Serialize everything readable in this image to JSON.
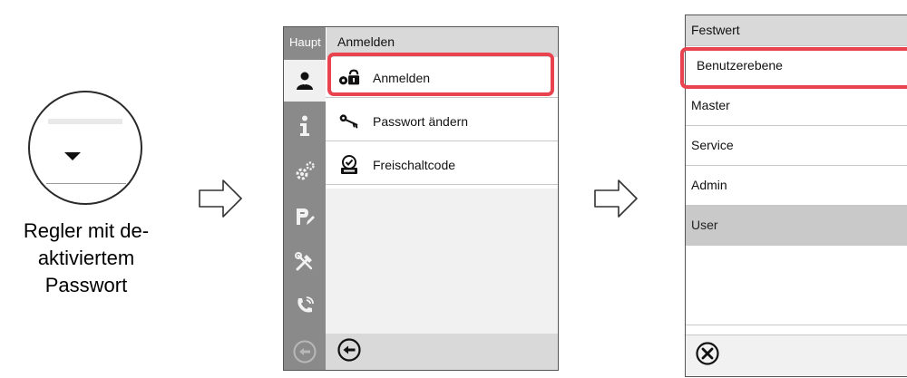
{
  "controller": {
    "caption_lines": [
      "Regler mit de-",
      "aktiviertem",
      "Passwort"
    ],
    "icon": "chevron-down-icon"
  },
  "login_screen": {
    "sidebar_title": "Haupt",
    "header_title": "Anmelden",
    "sidebar_icons": [
      "user-icon",
      "info-icon",
      "settings-icon",
      "program-edit-icon",
      "service-tools-icon",
      "phone-icon"
    ],
    "menu_items": [
      {
        "label": "Anmelden",
        "icon": "login-lock-icon",
        "highlighted": true
      },
      {
        "label": "Passwort ändern",
        "icon": "key-icon",
        "highlighted": false
      },
      {
        "label": "Freischaltcode",
        "icon": "activation-code-icon",
        "highlighted": false
      }
    ],
    "footer_icon": "back-icon"
  },
  "level_screen": {
    "header_title": "Festwert",
    "options": [
      {
        "label": "Benutzerebene",
        "highlighted": true
      },
      {
        "label": "Master"
      },
      {
        "label": "Service"
      },
      {
        "label": "Admin"
      },
      {
        "label": "User",
        "selected": true
      }
    ],
    "footer_icon": "cancel-icon"
  },
  "colors": {
    "highlight": "#e8434e",
    "sidebar": "#8a8a8a",
    "header_bg": "#d9d9d9",
    "selected_row": "#c9c9c9"
  }
}
